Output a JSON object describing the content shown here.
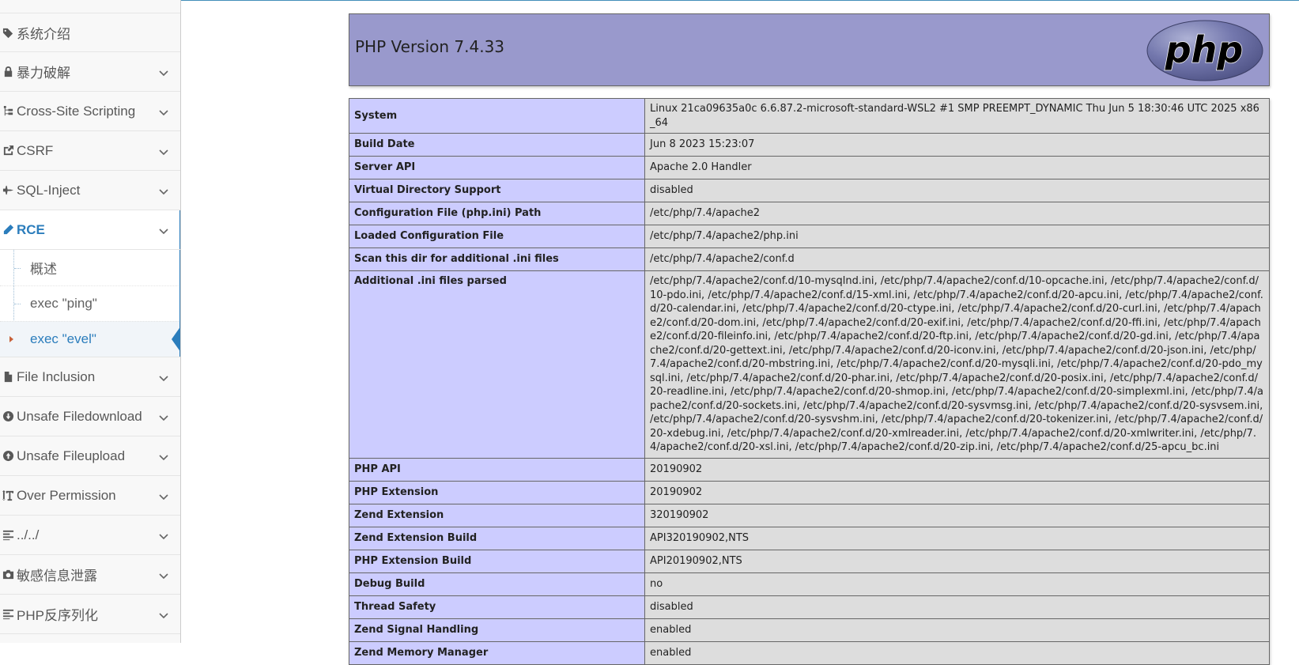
{
  "sidebar": {
    "items": [
      {
        "label": "系统介绍",
        "icon": "tags-icon",
        "chevron": false
      },
      {
        "label": "暴力破解",
        "icon": "lock-icon",
        "chevron": true
      },
      {
        "label": "Cross-Site Scripting",
        "icon": "sitemap-icon",
        "chevron": true
      },
      {
        "label": "CSRF",
        "icon": "share-icon",
        "chevron": true
      },
      {
        "label": "SQL-Inject",
        "icon": "fighter-jet-icon",
        "chevron": true
      },
      {
        "label": "RCE",
        "icon": "pencil-icon",
        "chevron": true,
        "active": true
      },
      {
        "label": "File Inclusion",
        "icon": "file-icon",
        "chevron": true
      },
      {
        "label": "Unsafe Filedownload",
        "icon": "download-icon",
        "chevron": true
      },
      {
        "label": "Unsafe Fileupload",
        "icon": "upload-icon",
        "chevron": true
      },
      {
        "label": "Over Permission",
        "icon": "text-height-icon",
        "chevron": true
      },
      {
        "label": "../../",
        "icon": "align-left-icon",
        "chevron": true
      },
      {
        "label": "敏感信息泄露",
        "icon": "camera-icon",
        "chevron": true
      },
      {
        "label": "PHP反序列化",
        "icon": "align-left-icon",
        "chevron": true
      }
    ],
    "rce_submenu": [
      {
        "label": "概述"
      },
      {
        "label": "exec \"ping\""
      },
      {
        "label": "exec \"evel\"",
        "active": true
      }
    ]
  },
  "php": {
    "version_title": "PHP Version 7.4.33",
    "logo_text": "php"
  },
  "info_rows": [
    {
      "key": "System",
      "value": "Linux 21ca09635a0c 6.6.87.2-microsoft-standard-WSL2 #1 SMP PREEMPT_DYNAMIC Thu Jun 5 18:30:46 UTC 2025 x86_64"
    },
    {
      "key": "Build Date",
      "value": "Jun 8 2023 15:23:07"
    },
    {
      "key": "Server API",
      "value": "Apache 2.0 Handler"
    },
    {
      "key": "Virtual Directory Support",
      "value": "disabled"
    },
    {
      "key": "Configuration File (php.ini) Path",
      "value": "/etc/php/7.4/apache2"
    },
    {
      "key": "Loaded Configuration File",
      "value": "/etc/php/7.4/apache2/php.ini"
    },
    {
      "key": "Scan this dir for additional .ini files",
      "value": "/etc/php/7.4/apache2/conf.d"
    },
    {
      "key": "Additional .ini files parsed",
      "value": "/etc/php/7.4/apache2/conf.d/10-mysqlnd.ini, /etc/php/7.4/apache2/conf.d/10-opcache.ini, /etc/php/7.4/apache2/conf.d/10-pdo.ini, /etc/php/7.4/apache2/conf.d/15-xml.ini, /etc/php/7.4/apache2/conf.d/20-apcu.ini, /etc/php/7.4/apache2/conf.d/20-calendar.ini, /etc/php/7.4/apache2/conf.d/20-ctype.ini, /etc/php/7.4/apache2/conf.d/20-curl.ini, /etc/php/7.4/apache2/conf.d/20-dom.ini, /etc/php/7.4/apache2/conf.d/20-exif.ini, /etc/php/7.4/apache2/conf.d/20-ffi.ini, /etc/php/7.4/apache2/conf.d/20-fileinfo.ini, /etc/php/7.4/apache2/conf.d/20-ftp.ini, /etc/php/7.4/apache2/conf.d/20-gd.ini, /etc/php/7.4/apache2/conf.d/20-gettext.ini, /etc/php/7.4/apache2/conf.d/20-iconv.ini, /etc/php/7.4/apache2/conf.d/20-json.ini, /etc/php/7.4/apache2/conf.d/20-mbstring.ini, /etc/php/7.4/apache2/conf.d/20-mysqli.ini, /etc/php/7.4/apache2/conf.d/20-pdo_mysql.ini, /etc/php/7.4/apache2/conf.d/20-phar.ini, /etc/php/7.4/apache2/conf.d/20-posix.ini, /etc/php/7.4/apache2/conf.d/20-readline.ini, /etc/php/7.4/apache2/conf.d/20-shmop.ini, /etc/php/7.4/apache2/conf.d/20-simplexml.ini, /etc/php/7.4/apache2/conf.d/20-sockets.ini, /etc/php/7.4/apache2/conf.d/20-sysvmsg.ini, /etc/php/7.4/apache2/conf.d/20-sysvsem.ini, /etc/php/7.4/apache2/conf.d/20-sysvshm.ini, /etc/php/7.4/apache2/conf.d/20-tokenizer.ini, /etc/php/7.4/apache2/conf.d/20-xdebug.ini, /etc/php/7.4/apache2/conf.d/20-xmlreader.ini, /etc/php/7.4/apache2/conf.d/20-xmlwriter.ini, /etc/php/7.4/apache2/conf.d/20-xsl.ini, /etc/php/7.4/apache2/conf.d/20-zip.ini, /etc/php/7.4/apache2/conf.d/25-apcu_bc.ini",
      "tall": true
    },
    {
      "key": "PHP API",
      "value": "20190902"
    },
    {
      "key": "PHP Extension",
      "value": "20190902"
    },
    {
      "key": "Zend Extension",
      "value": "320190902"
    },
    {
      "key": "Zend Extension Build",
      "value": "API320190902,NTS"
    },
    {
      "key": "PHP Extension Build",
      "value": "API20190902,NTS"
    },
    {
      "key": "Debug Build",
      "value": "no"
    },
    {
      "key": "Thread Safety",
      "value": "disabled"
    },
    {
      "key": "Zend Signal Handling",
      "value": "enabled"
    },
    {
      "key": "Zend Memory Manager",
      "value": "enabled"
    }
  ],
  "colors": {
    "accent": "#2b7dbc",
    "php_header": "#9999cc",
    "key_cell": "#ccccff",
    "value_cell": "#dddddd"
  }
}
